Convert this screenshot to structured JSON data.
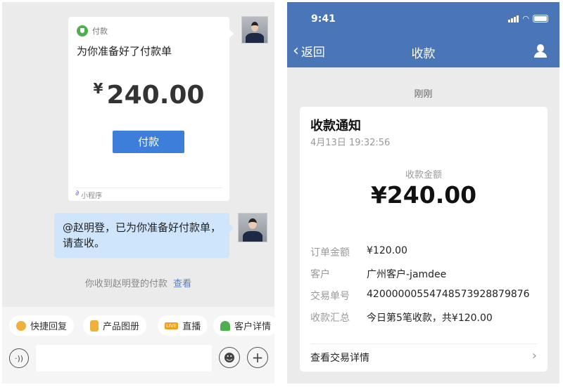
{
  "chat": {
    "card": {
      "source": "付款",
      "title": "为你准备好了付款单",
      "currency": "¥",
      "amount": "240.00",
      "pay_button": "付款",
      "footer": "小程序"
    },
    "message": "@赵明登，已为你准备好付款单，请查收。",
    "notice": {
      "text": "你收到赵明登的付款",
      "link": "查看"
    },
    "quick_actions": [
      {
        "label": "快捷回复",
        "icon": "quick-reply-icon"
      },
      {
        "label": "产品图册",
        "icon": "catalog-icon"
      },
      {
        "label": "直播",
        "icon": "live-icon",
        "badge": "LIVE"
      },
      {
        "label": "客户详情",
        "icon": "customer-icon"
      }
    ],
    "input": {
      "placeholder": "",
      "value": ""
    }
  },
  "receipt": {
    "status_time": "9:41",
    "back": "返回",
    "title": "收款",
    "time_label": "刚刚",
    "card": {
      "title": "收款通知",
      "datetime": "4月13日 19:32:56",
      "amount_label": "收款金额",
      "amount": "¥240.00",
      "rows": [
        {
          "k": "订单金额",
          "v": "¥120.00"
        },
        {
          "k": "客户",
          "v": "广州客户-jamdee"
        },
        {
          "k": "交易单号",
          "v": "42000000554748573928879876"
        },
        {
          "k": "收款汇总",
          "v": "今日第5笔收款，共¥120.00"
        }
      ],
      "detail_link": "查看交易详情"
    }
  },
  "colors": {
    "header": "#4a76b8",
    "button": "#3d7edb",
    "link": "#5a7fc4",
    "bubble": "#cfe5fb"
  }
}
